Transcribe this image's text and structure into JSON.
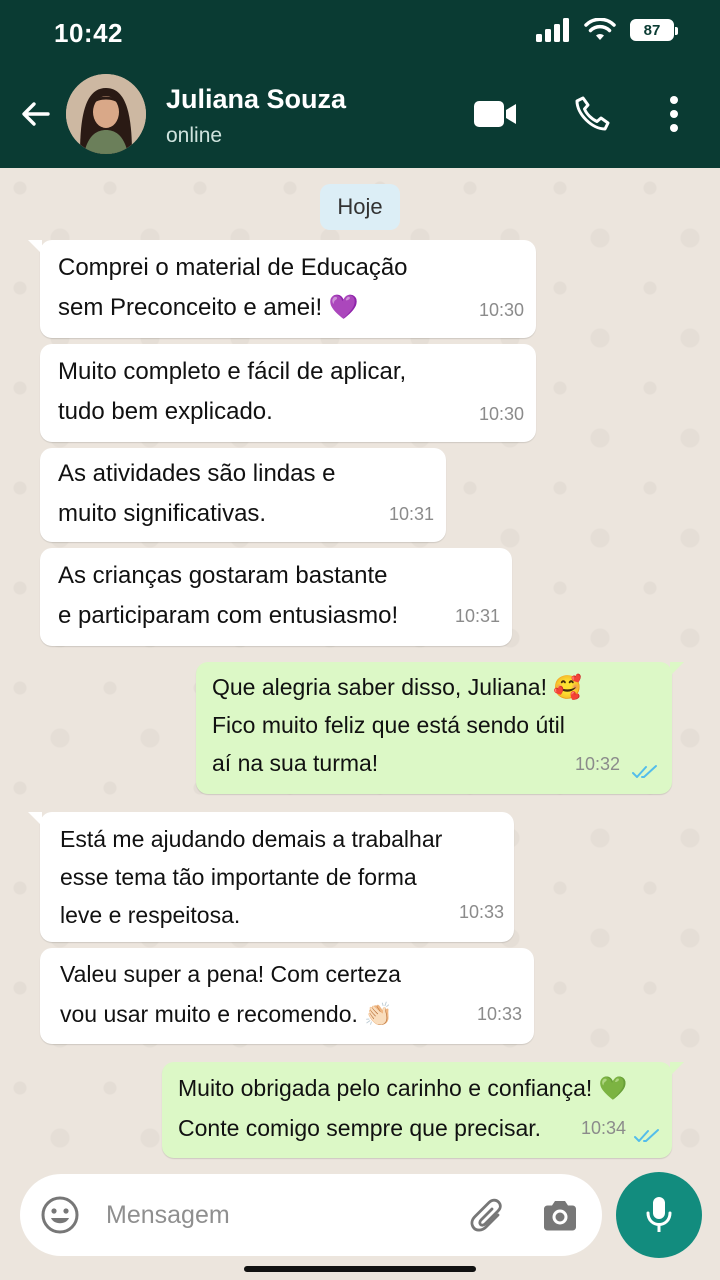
{
  "status_bar": {
    "time": "10:42",
    "battery": "87"
  },
  "header": {
    "contact_name": "Juliana Souza",
    "contact_status": "online"
  },
  "chat": {
    "date_label": "Hoje",
    "messages": [
      {
        "direction": "incoming",
        "text": "Comprei o material de Educação\nsem Preconceito e amei! 💜",
        "time": "10:30"
      },
      {
        "direction": "incoming",
        "text": "Muito completo e fácil de aplicar,\ntudo bem explicado.",
        "time": "10:30"
      },
      {
        "direction": "incoming",
        "text": "As atividades são lindas e\nmuito significativas.",
        "time": "10:31"
      },
      {
        "direction": "incoming",
        "text": "As crianças gostaram bastante\ne participaram com entusiasmo!",
        "time": "10:31"
      },
      {
        "direction": "outgoing",
        "text": "Que alegria saber disso, Juliana! 🥰\nFico muito feliz que está sendo útil\naí na sua turma!",
        "time": "10:32",
        "read": true
      },
      {
        "direction": "incoming",
        "text": "Está me ajudando demais a trabalhar\nesse tema tão importante de forma\nleve e respeitosa.",
        "time": "10:33"
      },
      {
        "direction": "incoming",
        "text": "Valeu super a pena! Com certeza\nvou usar muito e recomendo. 👏🏻",
        "time": "10:33"
      },
      {
        "direction": "outgoing",
        "text": "Muito obrigada pelo carinho e confiança! 💚\nConte comigo sempre que precisar.",
        "time": "10:34",
        "read": true
      }
    ]
  },
  "input": {
    "placeholder": "Mensagem"
  },
  "icons": {
    "back": "arrow-left-icon",
    "video": "video-camera-icon",
    "call": "phone-icon",
    "menu": "more-vertical-icon",
    "emoji": "emoji-icon",
    "attach": "paperclip-icon",
    "camera": "camera-icon",
    "mic": "microphone-icon",
    "read_receipt": "double-check-icon"
  },
  "colors": {
    "header": "#0A3B33",
    "chat_background": "#ECE5DD",
    "incoming_bubble": "#FFFFFF",
    "outgoing_bubble": "#DCF8C6",
    "date_chip": "#DCEEF6",
    "mic_button": "#128C7E",
    "read_ticks": "#53BDEB"
  }
}
